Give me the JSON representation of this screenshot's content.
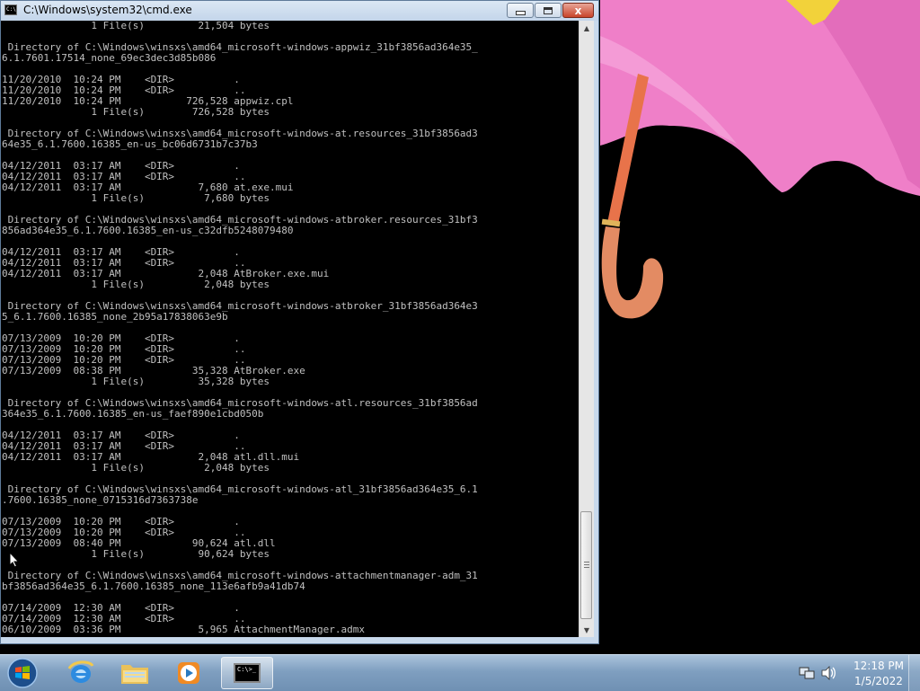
{
  "window": {
    "title": "C:\\Windows\\system32\\cmd.exe",
    "icon_text": "C:\\",
    "close_glyph": "x"
  },
  "console": {
    "lines": [
      "               1 File(s)         21,504 bytes",
      "",
      " Directory of C:\\Windows\\winsxs\\amd64_microsoft-windows-appwiz_31bf3856ad364e35_",
      "6.1.7601.17514_none_69ec3dec3d85b086",
      "",
      "11/20/2010  10:24 PM    <DIR>          .",
      "11/20/2010  10:24 PM    <DIR>          ..",
      "11/20/2010  10:24 PM           726,528 appwiz.cpl",
      "               1 File(s)        726,528 bytes",
      "",
      " Directory of C:\\Windows\\winsxs\\amd64_microsoft-windows-at.resources_31bf3856ad3",
      "64e35_6.1.7600.16385_en-us_bc06d6731b7c37b3",
      "",
      "04/12/2011  03:17 AM    <DIR>          .",
      "04/12/2011  03:17 AM    <DIR>          ..",
      "04/12/2011  03:17 AM             7,680 at.exe.mui",
      "               1 File(s)          7,680 bytes",
      "",
      " Directory of C:\\Windows\\winsxs\\amd64_microsoft-windows-atbroker.resources_31bf3",
      "856ad364e35_6.1.7600.16385_en-us_c32dfb5248079480",
      "",
      "04/12/2011  03:17 AM    <DIR>          .",
      "04/12/2011  03:17 AM    <DIR>          ..",
      "04/12/2011  03:17 AM             2,048 AtBroker.exe.mui",
      "               1 File(s)          2,048 bytes",
      "",
      " Directory of C:\\Windows\\winsxs\\amd64_microsoft-windows-atbroker_31bf3856ad364e3",
      "5_6.1.7600.16385_none_2b95a17838063e9b",
      "",
      "07/13/2009  10:20 PM    <DIR>          .",
      "07/13/2009  10:20 PM    <DIR>          ..",
      "07/13/2009  10:20 PM    <DIR>          ..",
      "07/13/2009  08:38 PM            35,328 AtBroker.exe",
      "               1 File(s)         35,328 bytes",
      "",
      " Directory of C:\\Windows\\winsxs\\amd64_microsoft-windows-atl.resources_31bf3856ad",
      "364e35_6.1.7600.16385_en-us_faef890e1cbd050b",
      "",
      "04/12/2011  03:17 AM    <DIR>          .",
      "04/12/2011  03:17 AM    <DIR>          ..",
      "04/12/2011  03:17 AM             2,048 atl.dll.mui",
      "               1 File(s)          2,048 bytes",
      "",
      " Directory of C:\\Windows\\winsxs\\amd64_microsoft-windows-atl_31bf3856ad364e35_6.1",
      ".7600.16385_none_0715316d7363738e",
      "",
      "07/13/2009  10:20 PM    <DIR>          .",
      "07/13/2009  10:20 PM    <DIR>          ..",
      "07/13/2009  08:40 PM            90,624 atl.dll",
      "               1 File(s)         90,624 bytes",
      "",
      " Directory of C:\\Windows\\winsxs\\amd64_microsoft-windows-attachmentmanager-adm_31",
      "bf3856ad364e35_6.1.7600.16385_none_113e6afb9a41db74",
      "",
      "07/14/2009  12:30 AM    <DIR>          .",
      "07/14/2009  12:30 AM    <DIR>          ..",
      "06/10/2009  03:36 PM             5,965 AttachmentManager.admx"
    ]
  },
  "taskbar": {
    "items": [
      {
        "name": "start-button",
        "icon": "windows-orb-icon"
      },
      {
        "name": "internet-explorer",
        "icon": "internet-explorer-icon"
      },
      {
        "name": "windows-explorer",
        "icon": "folder-icon"
      },
      {
        "name": "windows-media-player",
        "icon": "media-player-icon"
      },
      {
        "name": "command-prompt",
        "icon": "command-prompt-icon",
        "active": true
      }
    ],
    "cmd_icon_text": "C:\\>_",
    "clock": {
      "time": "12:18 PM",
      "date": "1/5/2022"
    },
    "tray_icons": [
      "network-icon",
      "volume-icon"
    ]
  },
  "colors": {
    "console_bg": "#000000",
    "console_fg": "#c0c0c0",
    "titlebar": "#c8d9ec",
    "close_button": "#c8442a",
    "taskbar": "#7f9fc0",
    "umbrella_canopy": "#ef7fc8",
    "umbrella_handle": "#e8734a"
  }
}
